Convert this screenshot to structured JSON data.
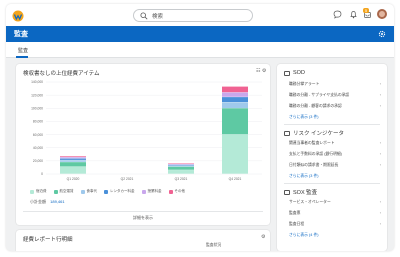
{
  "app": {
    "logo": "W"
  },
  "search": {
    "placeholder": "検索"
  },
  "topbar": {
    "notification_count": "5"
  },
  "page": {
    "title": "監査",
    "tab": "監査"
  },
  "chart_card": {
    "title": "検収書なしの上位経費アイテム",
    "total_label": "小計金額",
    "total_value": "189,461",
    "details_link": "詳細を表示"
  },
  "chart_data": {
    "type": "bar",
    "stacked": true,
    "categories": [
      "Q1 2020",
      "Q2 2021",
      "Q3 2021",
      "Q4 2021"
    ],
    "ylim": [
      0,
      140000
    ],
    "yticks": [
      "140,000",
      "120,000",
      "100,000",
      "80,000",
      "60,000",
      "40,000",
      "20,000",
      "0"
    ],
    "series": [
      {
        "name": "宿泊費",
        "color": "#b4ead7",
        "values": [
          11000,
          0,
          6000,
          60000
        ]
      },
      {
        "name": "航空運賃",
        "color": "#5ec9a3",
        "values": [
          7000,
          0,
          5000,
          40000
        ]
      },
      {
        "name": "食事代",
        "color": "#9fc9ec",
        "values": [
          3000,
          0,
          1500,
          9000
        ]
      },
      {
        "name": "レンタカー料金",
        "color": "#4a90d9",
        "values": [
          2500,
          0,
          1500,
          8000
        ]
      },
      {
        "name": "授業料金",
        "color": "#c9a7ec",
        "values": [
          2000,
          0,
          1000,
          7000
        ]
      },
      {
        "name": "その他",
        "color": "#f06292",
        "values": [
          1500,
          0,
          1000,
          9000
        ]
      }
    ]
  },
  "report_card": {
    "title": "経費レポート行明細",
    "column": "監査状況"
  },
  "side": {
    "sections": [
      {
        "title": "SOD",
        "items": [
          "職務分掌アラート",
          "職務の分離 - サプライヤ支払の承認",
          "職務の分離 - 顧客の請求の承認"
        ],
        "more": "さらに表示 (3 件)"
      },
      {
        "title": "リスク インジケータ",
        "items": [
          "関連当事者の監査レポート",
          "支払と手数料の承認 (銀行明細)",
          "日付類似の請求書・期限延長"
        ],
        "more": "さらに表示 (3 件)"
      },
      {
        "title": "SOX 監査",
        "items": [
          "サービス・オペレーター",
          "監査票",
          "監査日程"
        ],
        "more": "さらに表示 (4 件)"
      }
    ]
  }
}
